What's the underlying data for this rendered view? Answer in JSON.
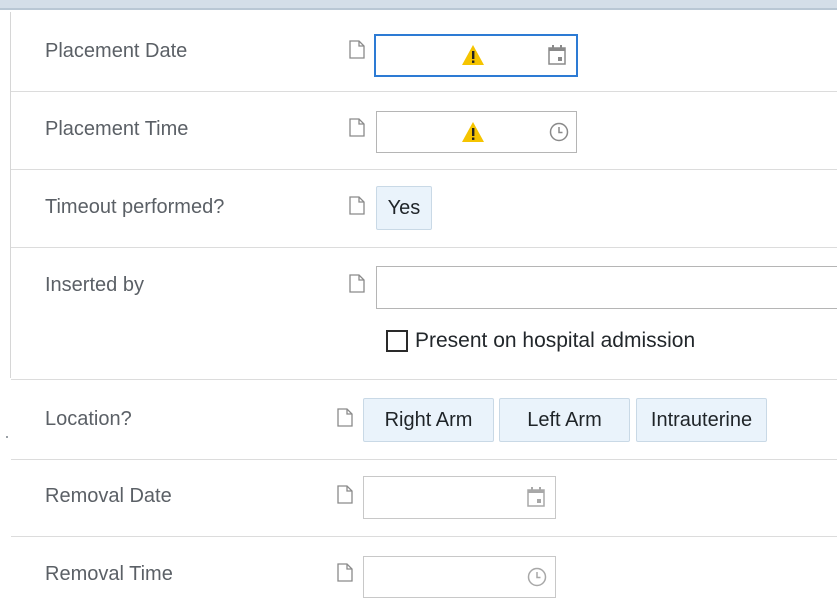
{
  "fields": {
    "placement_date": {
      "label": "Placement Date"
    },
    "placement_time": {
      "label": "Placement Time"
    },
    "timeout_performed": {
      "label": "Timeout performed?",
      "option": "Yes"
    },
    "inserted_by": {
      "label": "Inserted by",
      "checkbox_label": "Present on hospital admission",
      "checked": false
    },
    "location": {
      "label": "Location?",
      "options": [
        "Right Arm",
        "Left Arm",
        "Intrauterine"
      ]
    },
    "removal_date": {
      "label": "Removal Date"
    },
    "removal_time": {
      "label": "Removal Time"
    }
  },
  "icons": {
    "document": "document-icon",
    "warning": "warning-icon",
    "calendar": "calendar-icon",
    "clock": "clock-icon"
  },
  "colors": {
    "focus_border": "#2d7bd4",
    "warning": "#f5c400",
    "option_bg": "#eaf3fb"
  }
}
